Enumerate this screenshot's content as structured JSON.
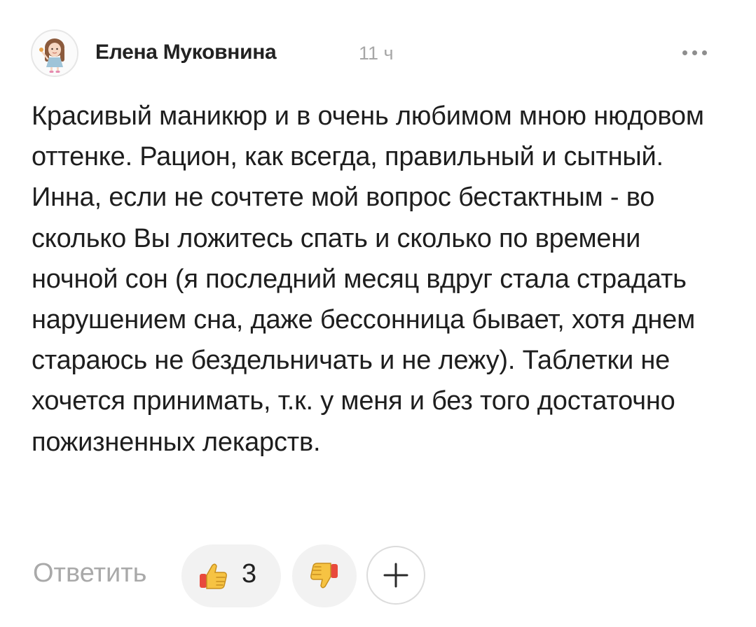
{
  "comment": {
    "author": "Елена Муковнина",
    "time": "11 ч",
    "text": "Красивый маникюр и в очень любимом мною нюдовом оттенке. Рацион, как всегда, правильный и сытный. Инна, если не сочтете мой вопрос бестактным - во сколько Вы ложитесь спать и сколько по времени ночной сон (я последний месяц вдруг стала страдать нарушением сна, даже бессонница бывает, хотя днем стараюсь не бездельничать и не лежу). Таблетки не хочется принимать, т.к. у меня и без того достаточно пожизненных лекарств."
  },
  "actions": {
    "reply_label": "Ответить",
    "like_count": "3",
    "like_icon": "thumbs-up-icon",
    "dislike_icon": "thumbs-down-icon",
    "add_icon": "plus-icon"
  },
  "colors": {
    "text": "#1e1e1e",
    "muted": "#a9a9a9",
    "pill_bg": "#f2f2f2",
    "thumb_yellow": "#f6c343",
    "thumb_red": "#e84a3c"
  }
}
